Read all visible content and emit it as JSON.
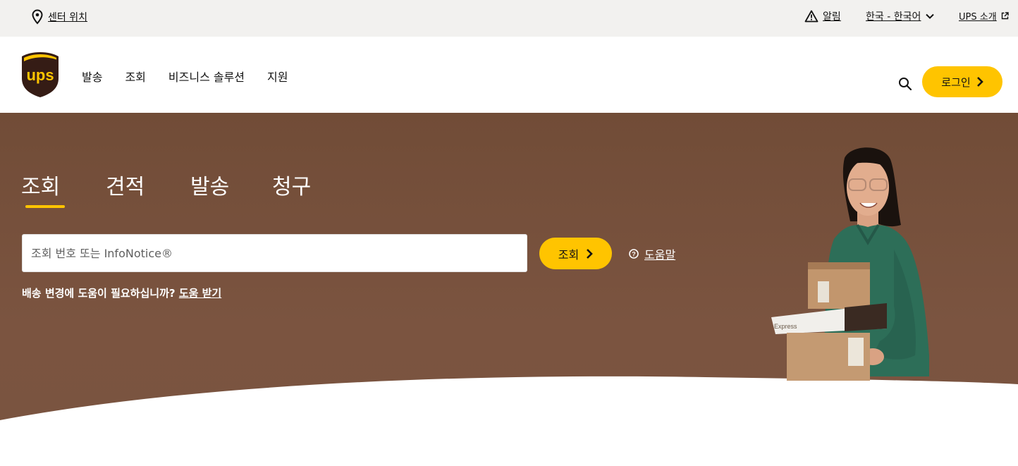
{
  "utility_bar": {
    "location_label": "센터 위치",
    "alerts_label": "알림",
    "language_label": "한국 - 한국어",
    "about_label": "UPS 소개"
  },
  "header": {
    "logo_text": "ups",
    "nav": [
      "발송",
      "조회",
      "비즈니스 솔루션",
      "지원"
    ],
    "login_label": "로그인"
  },
  "hero": {
    "tabs": [
      "조회",
      "견적",
      "발송",
      "청구"
    ],
    "active_tab": "조회",
    "tracking_placeholder": "조회 번호 또는 InfoNotice®",
    "tracking_value": "",
    "track_button_label": "조회",
    "help_label": "도움말",
    "delivery_help_text": "배송 변경에 도움이 필요하십니까?",
    "delivery_help_link": "도움 받기",
    "box_label": "Express"
  },
  "colors": {
    "brand_yellow": "#ffc400",
    "hero_brown": "#77503c",
    "ups_brown": "#351c15"
  }
}
